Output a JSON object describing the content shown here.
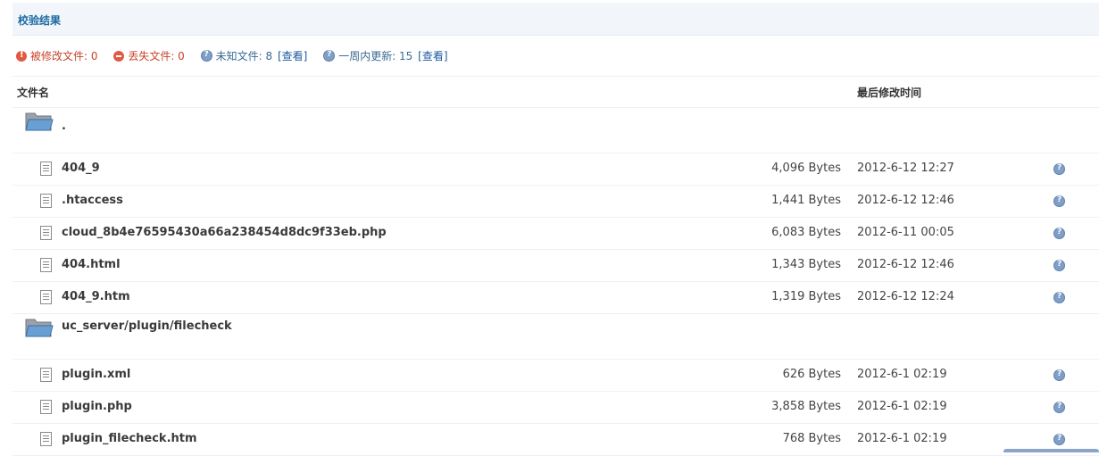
{
  "title": "校验结果",
  "summary": {
    "modified_label": "被修改文件: 0",
    "missing_label": "丢失文件: 0",
    "unknown_label": "未知文件: 8",
    "unknown_link": "[查看]",
    "week_label": "一周内更新: 15",
    "week_link": "[查看]"
  },
  "table": {
    "col_name": "文件名",
    "col_time": "最后修改时间"
  },
  "dirs": [
    {
      "name": ".",
      "files": [
        {
          "name": "404_9",
          "size": "4,096 Bytes",
          "time": "2012-6-12 12:27"
        },
        {
          "name": ".htaccess",
          "size": "1,441 Bytes",
          "time": "2012-6-12 12:46"
        },
        {
          "name": "cloud_8b4e76595430a66a238454d8dc9f33eb.php",
          "size": "6,083 Bytes",
          "time": "2012-6-11 00:05"
        },
        {
          "name": "404.html",
          "size": "1,343 Bytes",
          "time": "2012-6-12 12:46"
        },
        {
          "name": "404_9.htm",
          "size": "1,319 Bytes",
          "time": "2012-6-12 12:24"
        }
      ]
    },
    {
      "name": "uc_server/plugin/filecheck",
      "files": [
        {
          "name": "plugin.xml",
          "size": "626 Bytes",
          "time": "2012-6-1 02:19"
        },
        {
          "name": "plugin.php",
          "size": "3,858 Bytes",
          "time": "2012-6-1 02:19"
        },
        {
          "name": "plugin_filecheck.htm",
          "size": "768 Bytes",
          "time": "2012-6-1 02:19"
        }
      ]
    }
  ]
}
